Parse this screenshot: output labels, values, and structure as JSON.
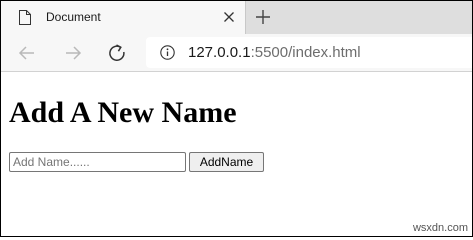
{
  "browser": {
    "tab": {
      "title": "Document",
      "icon": "document-icon",
      "close_icon": "close-icon"
    },
    "new_tab_icon": "plus-icon",
    "toolbar": {
      "back_icon": "arrow-left-icon",
      "forward_icon": "arrow-right-icon",
      "reload_icon": "reload-icon",
      "info_icon": "info-icon"
    },
    "address": {
      "host": "127.0.0.1",
      "rest": ":5500/index.html"
    }
  },
  "page": {
    "heading": "Add A New Name",
    "name_input": {
      "value": "",
      "placeholder": "Add Name......"
    },
    "add_button_label": "AddName"
  },
  "watermark": "wsxdn.com",
  "colors": {
    "tabstrip_bg": "#dedede",
    "tab_bg": "#f7f7f7",
    "url_host": "#1a1a1a",
    "url_rest": "#6d6d6d",
    "button_bg": "#efefef",
    "frame_border": "#000000"
  }
}
